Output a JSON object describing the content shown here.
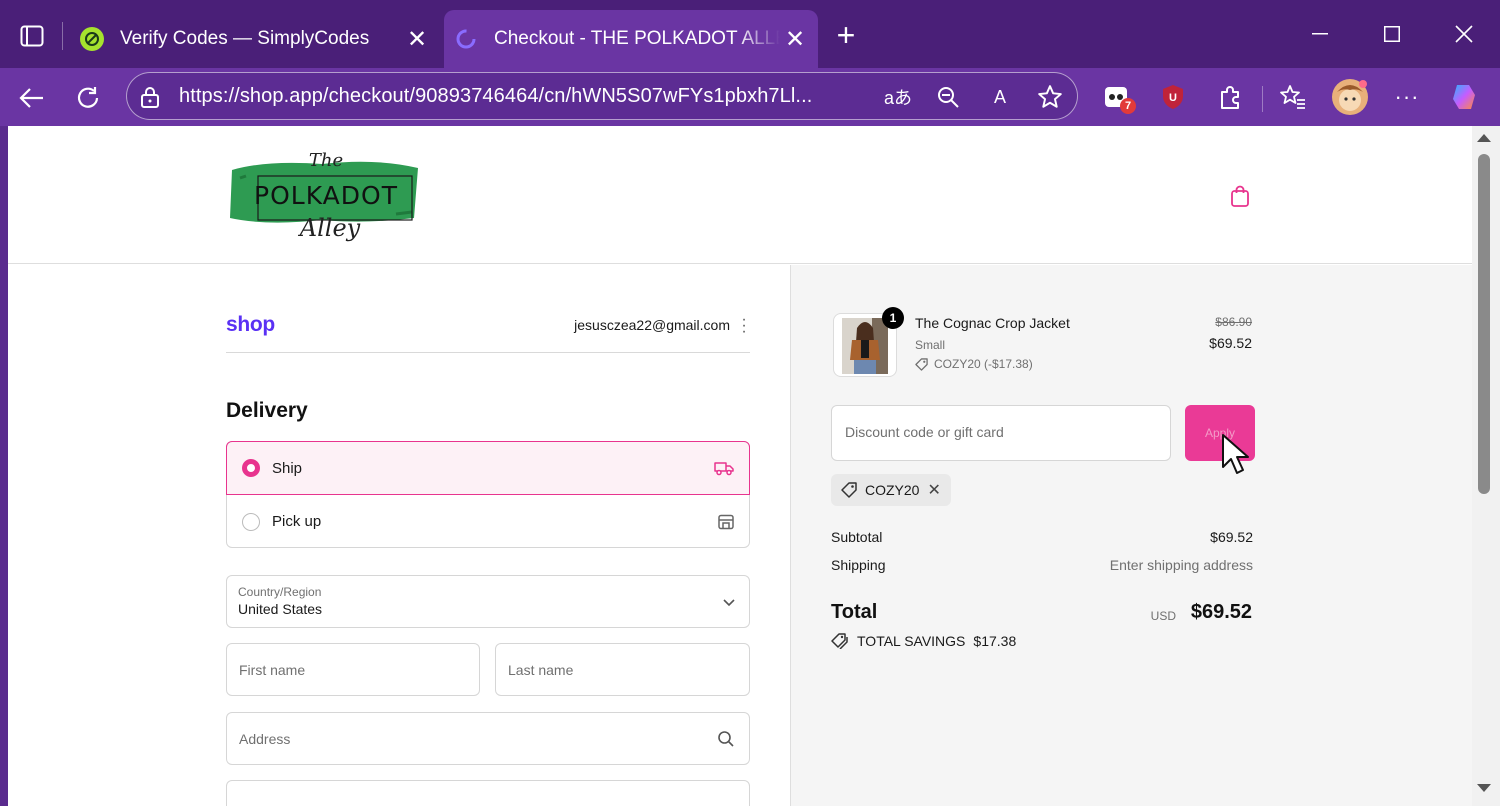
{
  "browser": {
    "tabs": [
      {
        "title": "Verify Codes — SimplyCodes",
        "favicon": "simplycodes-icon"
      },
      {
        "title": "Checkout - THE POLKADOT ALLEY",
        "favicon": "shop-icon"
      }
    ],
    "url": "https://shop.app/checkout/90893746464/cn/hWN5S07wFYs1pbxh7Ll...",
    "extension_badge": "7"
  },
  "store": {
    "logo_text": {
      "top": "The",
      "middle": "POLKADOT",
      "bottom": "Alley"
    }
  },
  "account": {
    "brand": "shop",
    "email": "jesusczea22@gmail.com"
  },
  "delivery": {
    "heading": "Delivery",
    "options": [
      {
        "label": "Ship",
        "selected": true
      },
      {
        "label": "Pick up",
        "selected": false
      }
    ],
    "country_label": "Country/Region",
    "country_value": "United States",
    "first_name_placeholder": "First name",
    "last_name_placeholder": "Last name",
    "address_placeholder": "Address"
  },
  "summary": {
    "item": {
      "quantity": "1",
      "name": "The Cognac Crop Jacket",
      "variant": "Small",
      "discount": "COZY20 (-$17.38)",
      "original_price": "$86.90",
      "price": "$69.52"
    },
    "discount_placeholder": "Discount code or gift card",
    "apply_label": "Apply",
    "applied_code": "COZY20",
    "subtotal_label": "Subtotal",
    "subtotal_value": "$69.52",
    "shipping_label": "Shipping",
    "shipping_value": "Enter shipping address",
    "total_label": "Total",
    "currency": "USD",
    "total_value": "$69.52",
    "savings_label": "TOTAL SAVINGS",
    "savings_value": "$17.38"
  },
  "colors": {
    "accent": "#e8348e",
    "shop_brand": "#5a31f4",
    "browser_frame": "#6a35a3"
  }
}
